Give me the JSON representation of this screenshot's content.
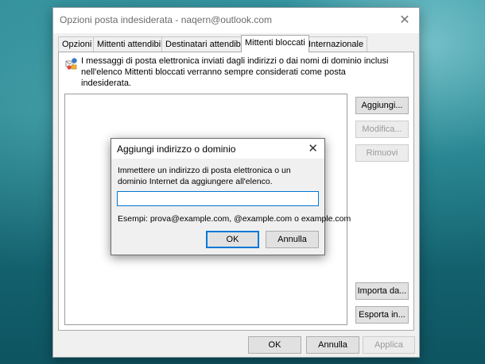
{
  "window": {
    "title": "Opzioni posta indesiderata - naqern@outlook.com",
    "close_glyph": "✕"
  },
  "tabs": [
    {
      "label": "Opzioni"
    },
    {
      "label": "Mittenti attendibili"
    },
    {
      "label": "Destinatari attendibili"
    },
    {
      "label": "Mittenti bloccati"
    },
    {
      "label": "Internazionale"
    }
  ],
  "panel": {
    "info_text": "I messaggi di posta elettronica inviati dagli indirizzi o dai nomi di dominio inclusi nell'elenco Mittenti bloccati verranno sempre considerati come posta indesiderata.",
    "buttons": {
      "add": "Aggiungi...",
      "edit": "Modifica...",
      "remove": "Rimuovi",
      "import": "Importa da...",
      "export": "Esporta in..."
    }
  },
  "footer": {
    "ok": "OK",
    "cancel": "Annulla",
    "apply": "Applica"
  },
  "dialog": {
    "title": "Aggiungi indirizzo o dominio",
    "close_glyph": "✕",
    "prompt": "Immettere un indirizzo di posta elettronica o un dominio Internet da aggiungere all'elenco.",
    "input_value": "",
    "example": "Esempi: prova@example.com, @example.com o example.com",
    "ok": "OK",
    "cancel": "Annulla"
  }
}
